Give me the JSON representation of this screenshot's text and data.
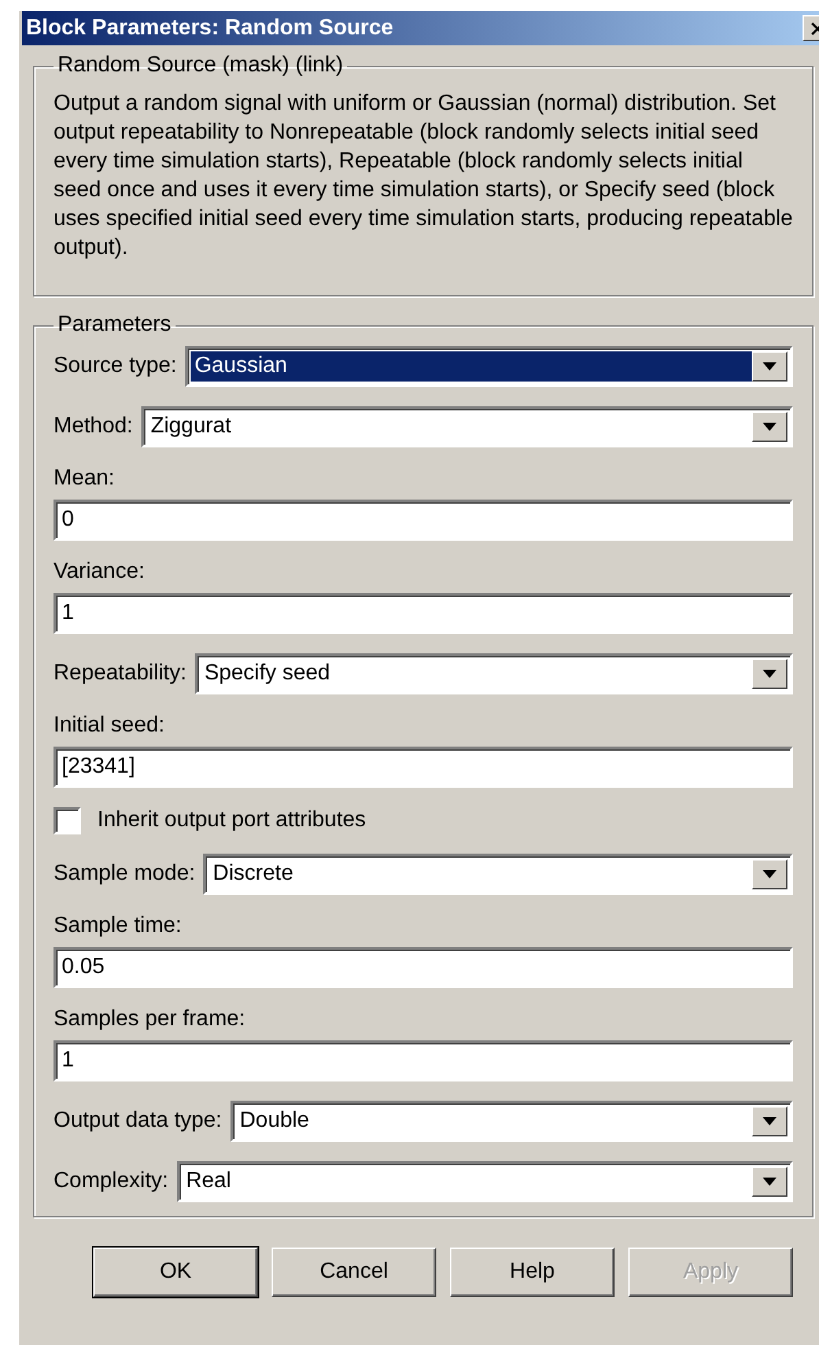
{
  "window": {
    "title": "Block Parameters: Random Source"
  },
  "description": {
    "heading": "Random Source (mask) (link)",
    "text": "Output a random signal with uniform or Gaussian (normal) distribution.  Set output repeatability to Nonrepeatable (block randomly selects initial seed every time simulation starts), Repeatable (block randomly selects initial seed once and uses it every time simulation starts), or Specify seed (block uses specified initial seed every time simulation starts, producing repeatable output)."
  },
  "parameters": {
    "heading": "Parameters",
    "items": [
      {
        "kind": "dropdown",
        "label": "Source type:",
        "value": "Gaussian",
        "highlighted": true
      },
      {
        "kind": "dropdown",
        "label": "Method:",
        "value": "Ziggurat",
        "highlighted": false
      },
      {
        "kind": "field",
        "label": "Mean:",
        "value": "0"
      },
      {
        "kind": "field",
        "label": "Variance:",
        "value": "1"
      },
      {
        "kind": "dropdown",
        "label": "Repeatability:",
        "value": "Specify seed",
        "highlighted": false
      },
      {
        "kind": "field",
        "label": "Initial seed:",
        "value": "[23341]"
      },
      {
        "kind": "checkbox",
        "label": "Inherit output port attributes",
        "checked": false
      },
      {
        "kind": "dropdown",
        "label": "Sample mode:",
        "value": "Discrete",
        "highlighted": false
      },
      {
        "kind": "field",
        "label": "Sample time:",
        "value": "0.05"
      },
      {
        "kind": "field",
        "label": "Samples per frame:",
        "value": "1"
      },
      {
        "kind": "dropdown",
        "label": "Output data type:",
        "value": "Double",
        "highlighted": false
      },
      {
        "kind": "dropdown",
        "label": "Complexity:",
        "value": "Real",
        "highlighted": false
      }
    ]
  },
  "buttons": [
    {
      "label": "OK",
      "default": true,
      "disabled": false
    },
    {
      "label": "Cancel",
      "default": false,
      "disabled": false
    },
    {
      "label": "Help",
      "default": false,
      "disabled": false
    },
    {
      "label": "Apply",
      "default": false,
      "disabled": true
    }
  ]
}
